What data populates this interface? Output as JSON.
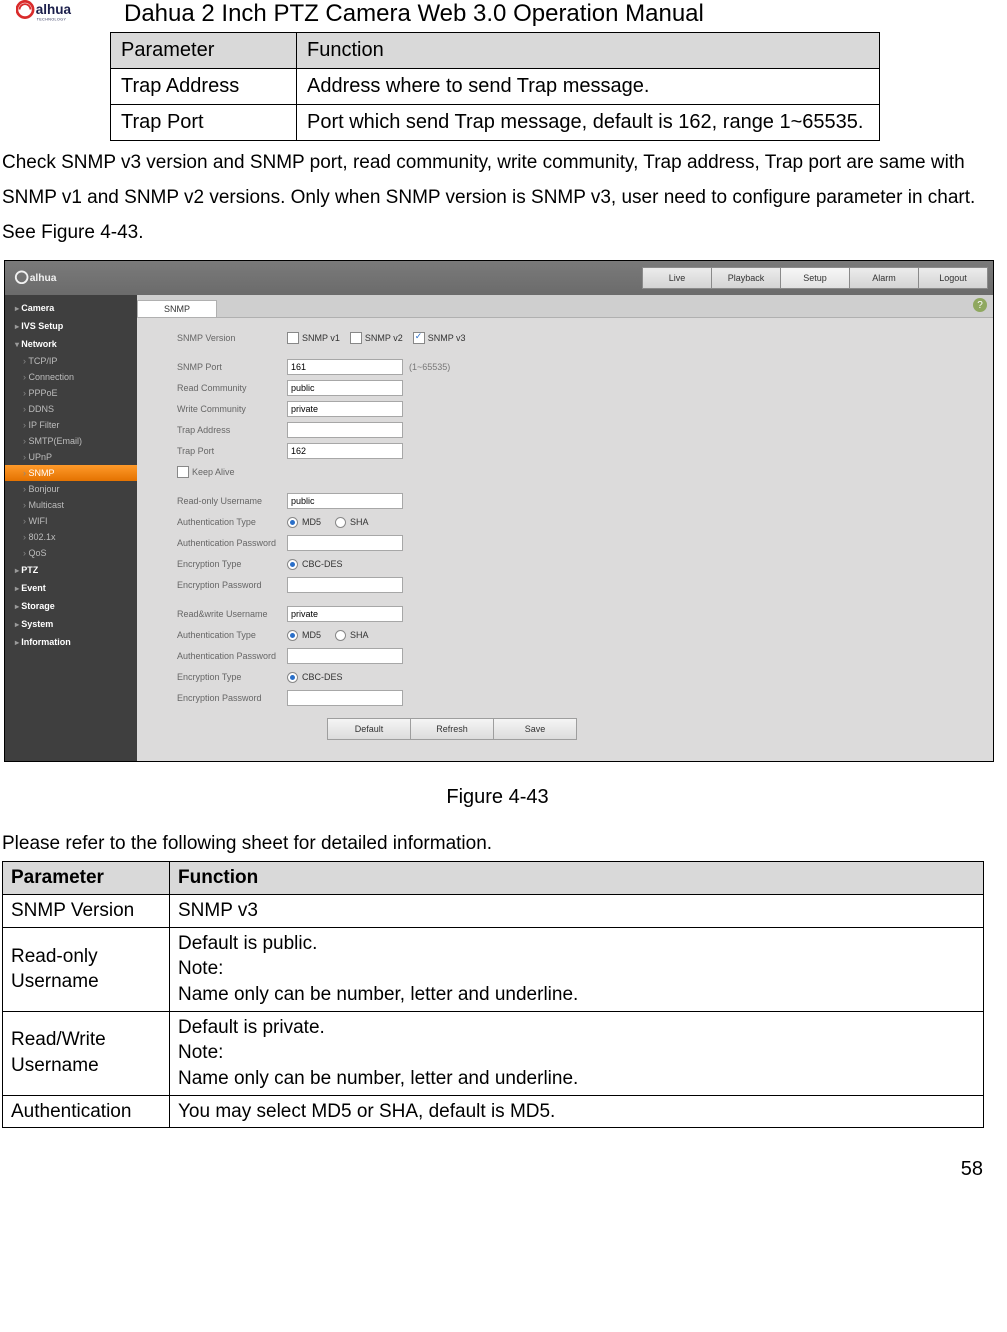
{
  "doc_title": "Dahua 2 Inch PTZ Camera Web 3.0 Operation Manual",
  "top_table": {
    "headers": [
      "Parameter",
      "Function"
    ],
    "rows": [
      {
        "param": "Trap Address",
        "func": "Address where to send Trap message."
      },
      {
        "param": "Trap Port",
        "func": "Port which send Trap message, default is 162, range 1~65535."
      }
    ]
  },
  "body_text": "Check SNMP v3 version and SNMP port, read community, write community, Trap address, Trap port are same with SNMP v1 and SNMP v2 versions. Only when SNMP version is SNMP v3, user need to configure parameter in chart. See Figure 4-43.",
  "ui": {
    "main_tabs": [
      "Live",
      "Playback",
      "Setup",
      "Alarm",
      "Logout"
    ],
    "active_main_tab": "Setup",
    "sub_tab": "SNMP",
    "sidebar_groups": [
      {
        "label": "Camera",
        "open": false,
        "items": []
      },
      {
        "label": "IVS Setup",
        "open": false,
        "items": []
      },
      {
        "label": "Network",
        "open": true,
        "items": [
          "TCP/IP",
          "Connection",
          "PPPoE",
          "DDNS",
          "IP Filter",
          "SMTP(Email)",
          "UPnP",
          "SNMP",
          "Bonjour",
          "Multicast",
          "WIFI",
          "802.1x",
          "QoS"
        ],
        "active": "SNMP"
      },
      {
        "label": "PTZ",
        "open": false,
        "items": []
      },
      {
        "label": "Event",
        "open": false,
        "items": []
      },
      {
        "label": "Storage",
        "open": false,
        "items": []
      },
      {
        "label": "System",
        "open": false,
        "items": []
      },
      {
        "label": "Information",
        "open": false,
        "items": []
      }
    ],
    "form": {
      "snmp_version_label": "SNMP Version",
      "snmp_v1": "SNMP v1",
      "snmp_v2": "SNMP v2",
      "snmp_v3": "SNMP v3",
      "snmp_port_label": "SNMP Port",
      "snmp_port_value": "161",
      "snmp_port_hint": "(1~65535)",
      "read_comm_label": "Read Community",
      "read_comm_value": "public",
      "write_comm_label": "Write Community",
      "write_comm_value": "private",
      "trap_addr_label": "Trap Address",
      "trap_addr_value": "",
      "trap_port_label": "Trap Port",
      "trap_port_value": "162",
      "keep_alive_label": "Keep Alive",
      "ro_user_label": "Read-only Username",
      "ro_user_value": "public",
      "auth_type_label": "Authentication Type",
      "auth_md5": "MD5",
      "auth_sha": "SHA",
      "auth_pwd_label": "Authentication Password",
      "enc_type_label": "Encryption Type",
      "enc_cbc": "CBC-DES",
      "enc_pwd_label": "Encryption Password",
      "rw_user_label": "Read&write Username",
      "rw_user_value": "private",
      "btn_default": "Default",
      "btn_refresh": "Refresh",
      "btn_save": "Save"
    }
  },
  "figure_caption": "Figure 4-43",
  "ref_text": "Please refer to the following sheet for detailed information.",
  "bottom_table": {
    "headers": [
      "Parameter",
      "Function"
    ],
    "rows": [
      {
        "param": "SNMP Version",
        "func": "SNMP v3"
      },
      {
        "param": "Read-only Username",
        "func": "Default is public.\nNote:\nName only can be number, letter and underline."
      },
      {
        "param": "Read/Write Username",
        "func": "Default is private.\nNote:\nName only can be number, letter and underline."
      },
      {
        "param": "Authentication",
        "func": "You may select MD5 or SHA, default is MD5."
      }
    ]
  },
  "page_number": "58"
}
